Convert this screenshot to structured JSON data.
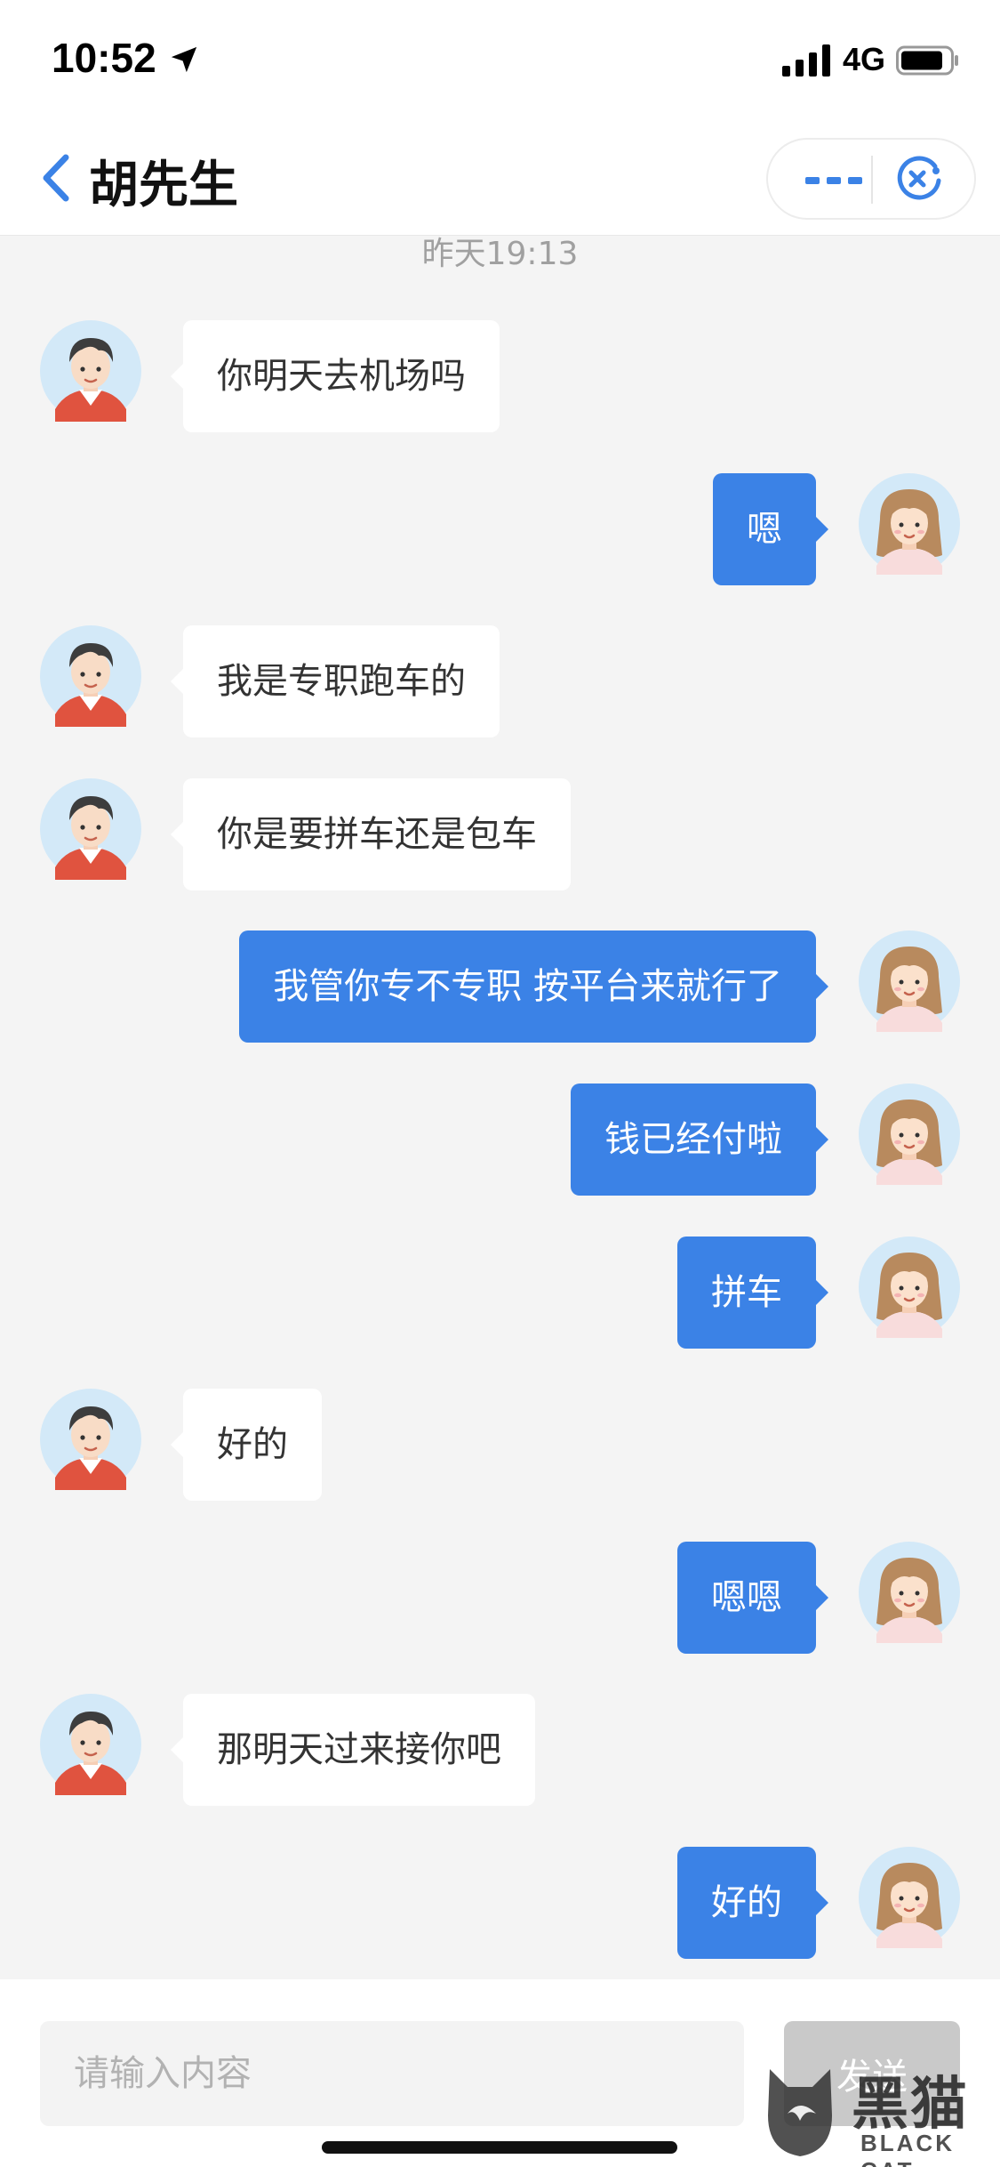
{
  "status_bar": {
    "time": "10:52",
    "network": "4G",
    "icons": [
      "location-arrow-icon",
      "signal-bars-icon",
      "battery-icon"
    ]
  },
  "header": {
    "title": "胡先生",
    "icons": [
      "back-chevron-icon",
      "more-dots-icon",
      "close-circle-icon"
    ],
    "accent_color": "#3b82e6"
  },
  "chat": {
    "timestamp": "昨天19:13",
    "messages": [
      {
        "from": "driver",
        "text": "你明天去机场吗"
      },
      {
        "from": "me",
        "text": "嗯"
      },
      {
        "from": "driver",
        "text": "我是专职跑车的"
      },
      {
        "from": "driver",
        "text": "你是要拼车还是包车"
      },
      {
        "from": "me",
        "text": "我管你专不专职 按平台来就行了"
      },
      {
        "from": "me",
        "text": "钱已经付啦"
      },
      {
        "from": "me",
        "text": "拼车"
      },
      {
        "from": "driver",
        "text": "好的"
      },
      {
        "from": "me",
        "text": "嗯嗯"
      },
      {
        "from": "driver",
        "text": "那明天过来接你吧"
      },
      {
        "from": "me",
        "text": "好的"
      }
    ],
    "colors": {
      "outgoing_bubble": "#3b82e6",
      "incoming_bubble": "#ffffff"
    }
  },
  "input_bar": {
    "placeholder": "请输入内容",
    "send_label": "发送"
  },
  "watermark": {
    "text_cn": "黑猫",
    "text_en": "BLACK CAT"
  }
}
